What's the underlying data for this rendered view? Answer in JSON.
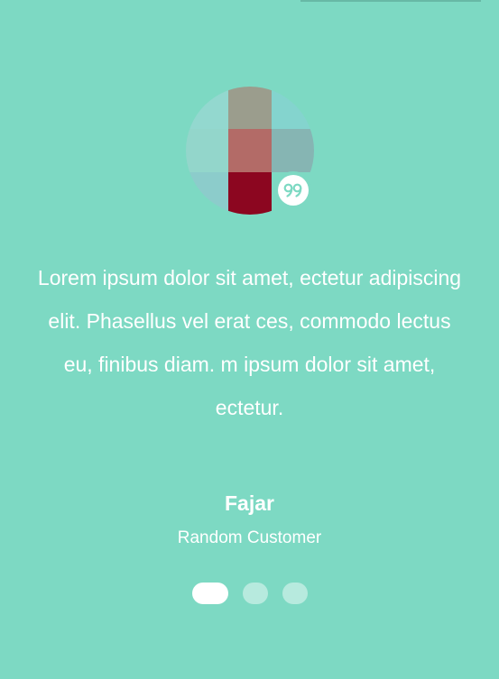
{
  "testimonial": {
    "quote": "Lorem ipsum dolor sit amet, ectetur adipiscing elit. Phasellus vel erat ces, commodo lectus eu, finibus diam. m ipsum dolor sit amet, ectetur.",
    "author_name": "Fajar",
    "author_role": "Random Customer",
    "quote_icon": "quote-icon"
  },
  "avatar": {
    "icon": "avatar-photo",
    "tiles": [
      "#93d8cf",
      "#9b9d8d",
      "#84d4ce",
      "#93d6cb",
      "#b36b67",
      "#86b5b3",
      "#8ccccb",
      "#8c0620",
      "#7dd9c3"
    ]
  },
  "carousel": {
    "slide_count": 3,
    "active_index": 0
  },
  "colors": {
    "background": "#7dd9c3",
    "text": "#ffffff",
    "dot_inactive": "rgba(255,255,255,0.45)",
    "dot_active": "#ffffff"
  }
}
